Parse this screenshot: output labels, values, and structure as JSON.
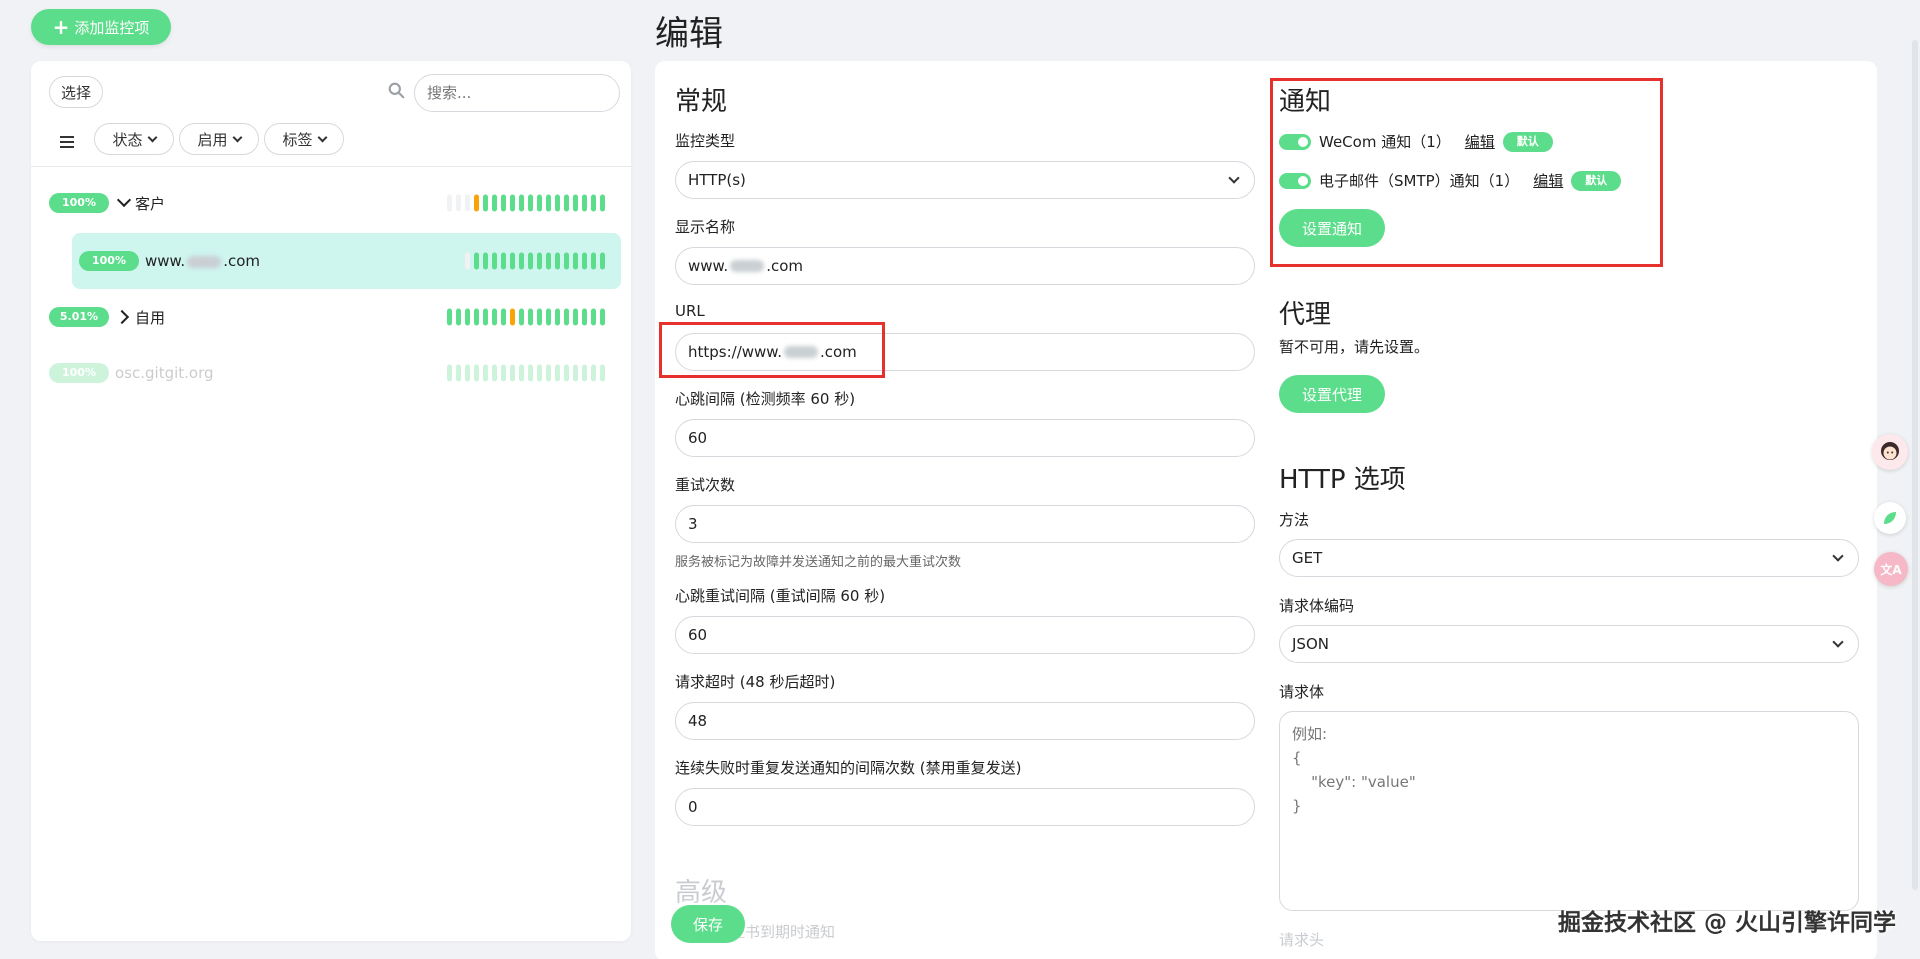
{
  "header": {
    "add_button": "添加监控项",
    "page_title": "编辑"
  },
  "list": {
    "select_label": "选择",
    "search_placeholder": "搜索...",
    "filters": [
      {
        "label": "状态"
      },
      {
        "label": "启用"
      },
      {
        "label": "标签"
      }
    ],
    "items": [
      {
        "uptime": "100%",
        "name": "客户",
        "type": "group-expanded"
      },
      {
        "uptime": "100%",
        "name_prefix": "www.",
        "name_suffix": ".com",
        "type": "child-selected"
      },
      {
        "uptime": "5.01%",
        "name": "自用",
        "type": "group-collapsed"
      },
      {
        "uptime": "100%",
        "name": "osc.gitgit.org",
        "type": "paused"
      }
    ]
  },
  "general": {
    "title": "常规",
    "monitor_type_label": "监控类型",
    "monitor_type_value": "HTTP(s)",
    "display_name_label": "显示名称",
    "display_name_prefix": "www.",
    "display_name_suffix": ".com",
    "url_label": "URL",
    "url_prefix": "https://www.",
    "url_suffix": ".com",
    "interval_label": "心跳间隔 (检测频率 60 秒)",
    "interval_value": "60",
    "retries_label": "重试次数",
    "retries_value": "3",
    "retries_help": "服务被标记为故障并发送通知之前的最大重试次数",
    "retry_interval_label": "心跳重试间隔 (重试间隔 60 秒)",
    "retry_interval_value": "60",
    "timeout_label": "请求超时 (48 秒后超时)",
    "timeout_value": "48",
    "resend_label": "连续失败时重复发送通知的间隔次数 (禁用重复发送)",
    "resend_value": "0",
    "advanced_title": "高级",
    "advanced_first_item": "证书到期时通知",
    "save_button": "保存"
  },
  "notifications": {
    "title": "通知",
    "items": [
      {
        "name": "WeCom 通知（1）",
        "edit": "编辑",
        "badge": "默认"
      },
      {
        "name": "电子邮件（SMTP）通知（1）",
        "edit": "编辑",
        "badge": "默认"
      }
    ],
    "setup_button": "设置通知"
  },
  "proxy": {
    "title": "代理",
    "note": "暂不可用，请先设置。",
    "setup_button": "设置代理"
  },
  "http_options": {
    "title": "HTTP 选项",
    "method_label": "方法",
    "method_value": "GET",
    "body_encoding_label": "请求体编码",
    "body_encoding_value": "JSON",
    "body_label": "请求体",
    "body_placeholder_lines": [
      "例如:",
      "{",
      "    \"key\": \"value\"",
      "}"
    ],
    "headers_label": "请求头"
  },
  "watermark": "掘金技术社区 @ 火山引擎许同学",
  "colors": {
    "accent": "#5cdd8b",
    "warning": "#f8a306",
    "highlight_box": "#e5302c",
    "selected_row": "#cff5ef"
  }
}
